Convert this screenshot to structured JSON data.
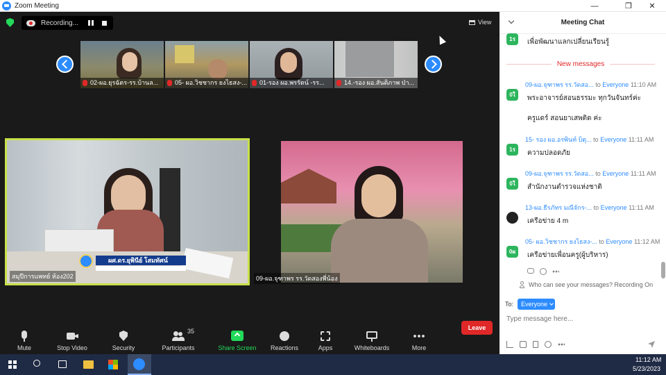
{
  "window": {
    "title": "Zoom Meeting",
    "minimize": "—",
    "restore": "❐",
    "close": "✕"
  },
  "topbar": {
    "recording_label": "Recording...",
    "view_label": "View"
  },
  "thumbnails": [
    {
      "name": "02-ผอ.ยุรฉัตร-รร.บ้านล..."
    },
    {
      "name": "05- ผอ.วิชชากร ยงไธสง-..."
    },
    {
      "name": "01-รอง ผอ.พรรัตน์ -รร..."
    },
    {
      "name": "14.-รอง ผอ.สันติภาพ ป่า..."
    }
  ],
  "videos": {
    "left_name": "สมุปีการแพทย์ ห้อง202",
    "left_banner": "ผศ.ดร.ยุพินีย์ โสมทัศน์",
    "right_name": "09-ผอ.จุฑาพร รร.วัดสองพี่น้อง"
  },
  "toolbar": {
    "mute": "Mute",
    "stop_video": "Stop Video",
    "security": "Security",
    "participants": "Participants",
    "participants_count": "35",
    "share_screen": "Share Screen",
    "reactions": "Reactions",
    "apps": "Apps",
    "whiteboards": "Whiteboards",
    "more": "More",
    "leave": "Leave"
  },
  "chat": {
    "title": "Meeting Chat",
    "new_messages": "New messages",
    "first_text": "เพื่อพัฒนาแลกเปลี่ยนเรียนรู้",
    "first_avatar": "1ร",
    "messages": [
      {
        "avatar": "0ใ",
        "sender": "09-ผอ.จุฑาพร  รร.วัดสอ...",
        "to": "to",
        "recipient": "Everyone",
        "time": "11:10 AM",
        "lines": [
          "พระอาจารย์สอนธรรมะ ทุกวันจันทร์ค่ะ",
          "ครูแดร์ สอนยาเสพติด ค่ะ"
        ]
      },
      {
        "avatar": "1ร",
        "sender": "15- รอง ผอ.อรพินท์ บิตุ...",
        "to": "to",
        "recipient": "Everyone",
        "time": "11:11 AM",
        "lines": [
          "ความปลอดภัย"
        ]
      },
      {
        "avatar": "0ใ",
        "sender": "09-ผอ.จุฑาพร  รร.วัดสอ...",
        "to": "to",
        "recipient": "Everyone",
        "time": "11:11 AM",
        "lines": [
          "สำนักงานตำรวจแห่งชาติ"
        ]
      },
      {
        "avatar": "",
        "sender": "13-ผอ.ธีรภัทร มณีจักร-...",
        "to": "to",
        "recipient": "Everyone",
        "time": "11:11 AM",
        "lines": [
          "เครือข่าย 4 m"
        ]
      },
      {
        "avatar": "0ผ",
        "sender": "05- ผอ.วิชชากร ยงไธสง-...",
        "to": "to",
        "recipient": "Everyone",
        "time": "11:12 AM",
        "lines": [
          "เครือข่ายเพื่อนครู(ผู้บริหาร)"
        ]
      }
    ],
    "who_can_see": "Who can see your messages? Recording On",
    "to_label": "To:",
    "to_value": "Everyone",
    "input_placeholder": "Type message here..."
  },
  "taskbar": {
    "time": "11:12 AM",
    "date": "5/23/2023"
  },
  "colors": {
    "accent": "#2d8cff",
    "green": "#23d959",
    "leave": "#e02828",
    "speaker_border": "#c8e04a"
  }
}
